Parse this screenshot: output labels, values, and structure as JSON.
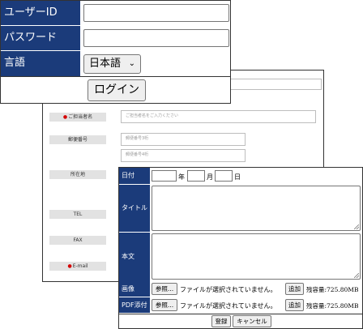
{
  "login": {
    "userid_label": "ユーザーID",
    "password_label": "パスワード",
    "language_label": "言語",
    "language_selected": "日本語",
    "login_button": "ログイン"
  },
  "contact_form": {
    "contact_person_label": "ご担当者名",
    "contact_person_placeholder": "ご担当者名をご入力ください",
    "postal_code_label": "郵便番号",
    "postal_code_1_placeholder": "郵便番号3桁",
    "postal_code_2_placeholder": "郵便番号4桁",
    "address_label": "所在地",
    "tel_label": "TEL",
    "fax_label": "FAX",
    "email_label": "E-mail"
  },
  "post_form": {
    "date_label": "日付",
    "year_unit": "年",
    "month_unit": "月",
    "day_unit": "日",
    "title_label": "タイトル",
    "body_label": "本文",
    "image_label": "画像",
    "pdf_label": "PDF添付",
    "browse_button": "参照...",
    "no_file_text": "ファイルが選択されていません。",
    "add_button": "追加",
    "remaining_capacity": "残容量:725.80MB",
    "register_button": "登録",
    "cancel_button": "キャンセル"
  },
  "colors": {
    "label_bg": "#1b3b7a",
    "gray_label_bg": "#e2e2e2",
    "required_mark": "#d40000"
  }
}
